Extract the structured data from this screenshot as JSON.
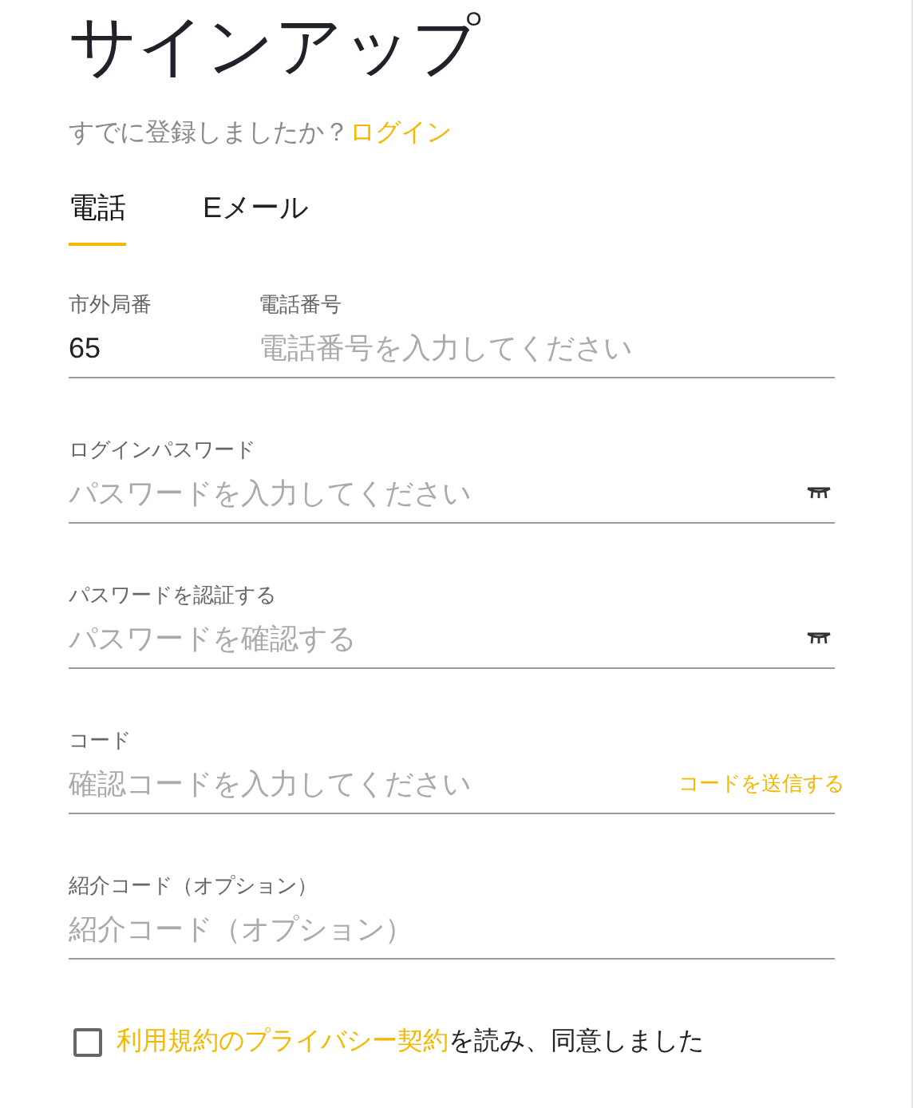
{
  "title": "サインアップ",
  "login_prompt": {
    "text": "すでに登録しましたか？",
    "link": "ログイン"
  },
  "tabs": [
    {
      "label": "電話",
      "selected": true
    },
    {
      "label": "Eメール",
      "selected": false
    }
  ],
  "fields": [
    {
      "kind": "phone",
      "area_label": "市外局番",
      "area_value": "65",
      "label": "電話番号",
      "placeholder": "電話番号を入力してください"
    },
    {
      "kind": "password",
      "label": "ログインパスワード",
      "placeholder": "パスワードを入力してください"
    },
    {
      "kind": "password",
      "label": "パスワードを認証する",
      "placeholder": "パスワードを確認する"
    },
    {
      "kind": "code",
      "label": "コード",
      "placeholder": "確認コードを入力してください",
      "action": "コードを送信する"
    },
    {
      "kind": "text",
      "label": "紹介コード（オプション）",
      "placeholder": "紹介コード（オプション）"
    }
  ],
  "agreement": {
    "checked": false,
    "link": "利用規約のプライバシー契約",
    "text": "を読み、同意しました"
  }
}
